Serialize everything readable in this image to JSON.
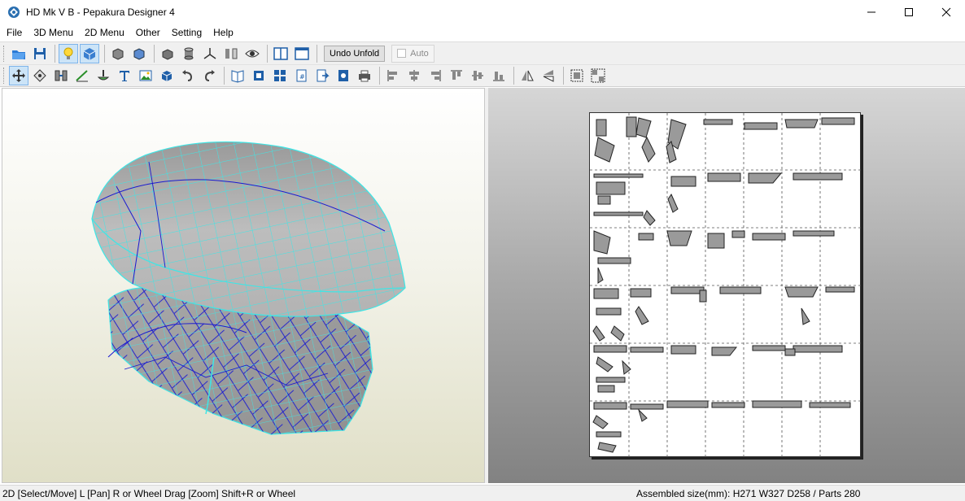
{
  "window": {
    "title": "HD Mk V B - Pepakura Designer 4"
  },
  "menu": [
    "File",
    "3D Menu",
    "2D Menu",
    "Other",
    "Setting",
    "Help"
  ],
  "toolbar1": {
    "icons": [
      "open-folder-icon",
      "save-icon",
      "light-bulb-icon",
      "texture-toggle-icon",
      "show-front-icon",
      "show-back-icon",
      "box-icon",
      "cylinder-icon",
      "axes-icon",
      "flip-icon",
      "eye-icon",
      "split-view-icon",
      "single-view-icon"
    ],
    "undo_unfold_label": "Undo Unfold",
    "auto_label": "Auto"
  },
  "toolbar2": {
    "icons": [
      "select-move-icon",
      "rotate-part-icon",
      "join-edge-icon",
      "fold-line-icon",
      "paint-icon",
      "text-icon",
      "image-icon",
      "3d-box-icon",
      "undo-icon",
      "redo-icon",
      "book-icon",
      "fit-page-icon",
      "arrange-icon",
      "page-number-icon",
      "export-icon",
      "print-preview-icon",
      "print-icon",
      "align-left-icon",
      "align-center-icon",
      "align-right-icon",
      "align-top-icon",
      "align-middle-icon",
      "align-bottom-icon",
      "flip-horizontal-icon",
      "flip-vertical-icon",
      "group-icon",
      "ungroup-icon"
    ]
  },
  "status": {
    "left": "2D [Select/Move] L [Pan] R or Wheel Drag [Zoom] Shift+R or Wheel",
    "right": "Assembled size(mm): H271 W327 D258 / Parts 280"
  },
  "colors": {
    "wire_cyan": "#3ee6e6",
    "wire_blue": "#1a1ad0",
    "mesh_gray": "#a9a9a9"
  }
}
